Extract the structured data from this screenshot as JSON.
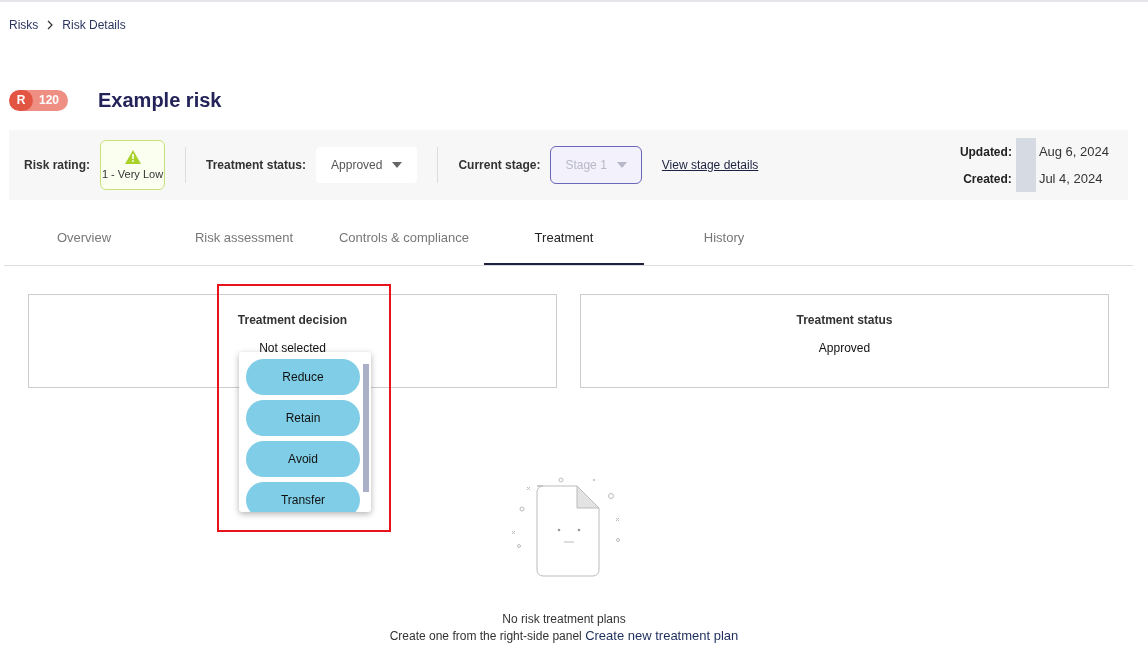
{
  "breadcrumb": [
    {
      "label": "Risks"
    },
    {
      "label": "Risk Details"
    }
  ],
  "risk": {
    "prefix": "R",
    "number": "120",
    "title": "Example risk"
  },
  "info_bar": {
    "risk_rating_label": "Risk rating:",
    "risk_rating": "1 - Very Low",
    "treatment_status_label": "Treatment status:",
    "treatment_status": "Approved",
    "current_stage_label": "Current stage:",
    "current_stage": "Stage 1",
    "stage_disabled": true,
    "stage_link": "View stage details",
    "dates": [
      {
        "label": "Updated:",
        "value": "Aug 6, 2024"
      },
      {
        "label": "Created:",
        "value": "Jul 4, 2024"
      }
    ]
  },
  "tabs": [
    {
      "label": "Overview",
      "selected": false
    },
    {
      "label": "Risk assessment",
      "selected": false
    },
    {
      "label": "Controls & compliance",
      "selected": false
    },
    {
      "label": "Treatment",
      "selected": true
    },
    {
      "label": "History",
      "selected": false
    }
  ],
  "cards": [
    {
      "title": "Treatment decision",
      "value": "Not selected"
    },
    {
      "title": "Treatment status",
      "value": "Approved"
    }
  ],
  "decision_menu": {
    "options": [
      {
        "label": "Reduce"
      },
      {
        "label": "Retain"
      },
      {
        "label": "Avoid"
      },
      {
        "label": "Transfer"
      }
    ]
  },
  "empty_state": {
    "title": "No risk treatment plans",
    "text": "Create one from the right-side panel",
    "link": "Create new treatment plan"
  }
}
